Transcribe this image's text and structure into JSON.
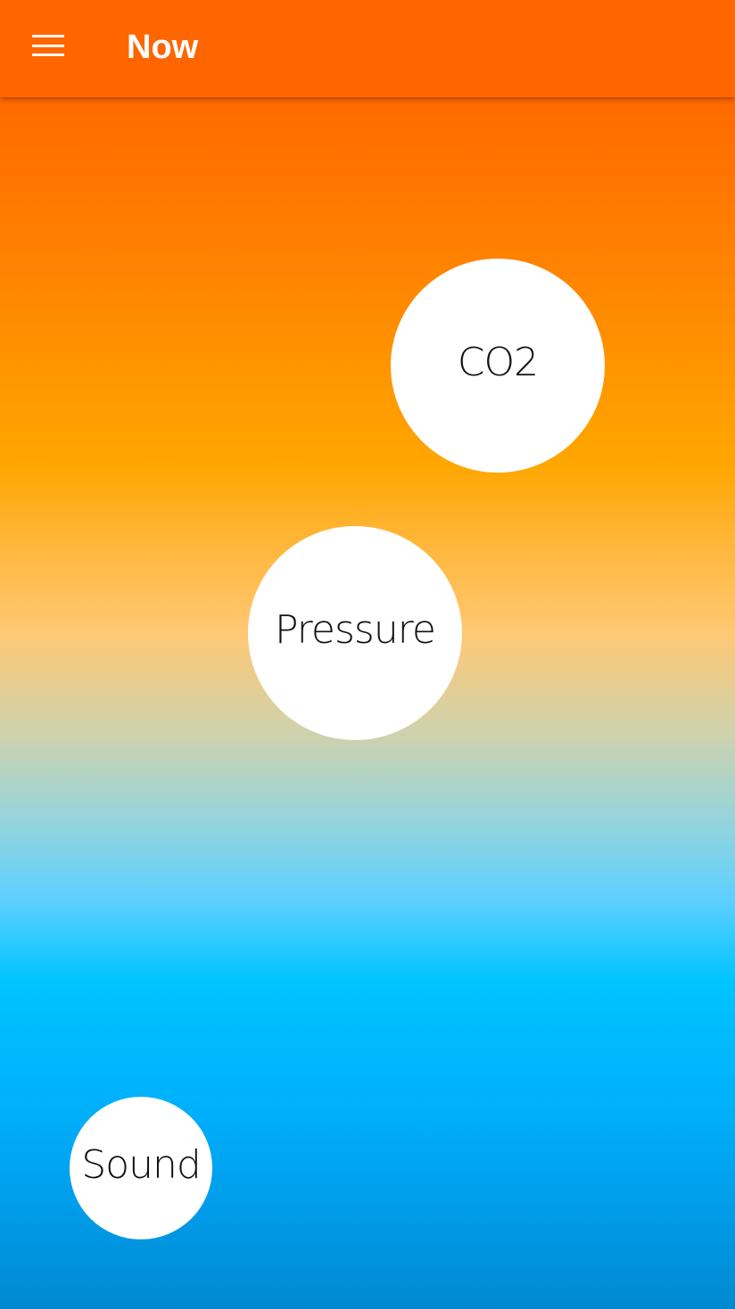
{
  "app_bar": {
    "title": "Now",
    "menu_icon": "menu-icon",
    "background_color": "#ff6600"
  },
  "bubbles": [
    {
      "label": "CO2"
    },
    {
      "label": "Pressure"
    },
    {
      "label": "Sound"
    }
  ],
  "colors": {
    "gradient_top": "#ff6200",
    "gradient_middle": "#ffc874",
    "gradient_bottom": "#0089d0",
    "bubble": "#ffffff"
  }
}
